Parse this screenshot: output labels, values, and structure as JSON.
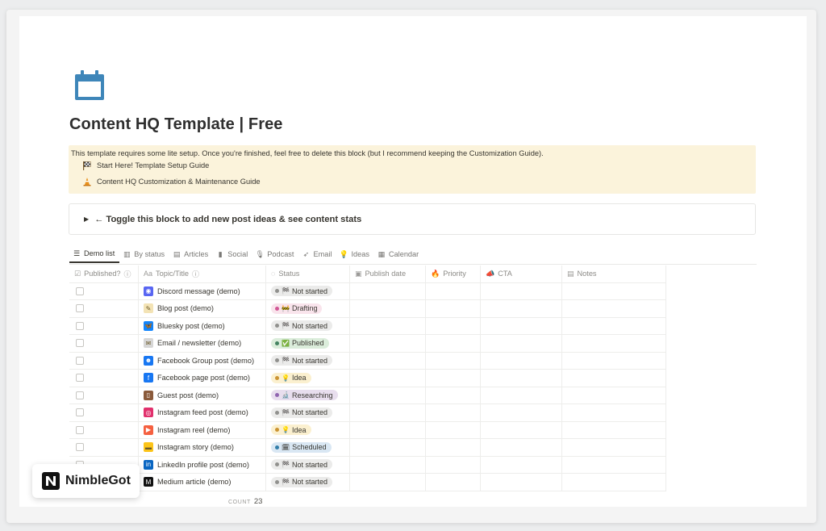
{
  "page": {
    "icon": "calendar-icon",
    "title": "Content HQ Template | Free"
  },
  "callout": {
    "text": "This template requires some lite setup. Once you're finished, feel free to delete this block (but I recommend keeping the Customization Guide).",
    "links": [
      {
        "icon": "checkered-flag-icon",
        "label": "Start Here! Template Setup Guide"
      },
      {
        "icon": "traffic-cone-icon",
        "label": "Content HQ Customization & Maintenance Guide"
      }
    ]
  },
  "toggle": {
    "label": "← Toggle this block to add new post ideas & see content stats"
  },
  "tabs": [
    {
      "icon": "list-icon",
      "label": "Demo list",
      "active": true
    },
    {
      "icon": "board-icon",
      "label": "By status"
    },
    {
      "icon": "gallery-icon",
      "label": "Articles"
    },
    {
      "icon": "phone-icon",
      "label": "Social"
    },
    {
      "icon": "microphone-icon",
      "label": "Podcast"
    },
    {
      "icon": "send-icon",
      "label": "Email"
    },
    {
      "icon": "lightbulb-icon",
      "label": "Ideas"
    },
    {
      "icon": "calendar-view-icon",
      "label": "Calendar"
    }
  ],
  "table": {
    "columns": [
      {
        "icon": "checkbox-icon",
        "label": "Published?",
        "info": "ⓘ"
      },
      {
        "icon": "text-aa-icon",
        "label": "Topic/Title",
        "info": "ⓘ"
      },
      {
        "icon": "status-icon",
        "label": "Status"
      },
      {
        "icon": "date-icon",
        "label": "Publish date"
      },
      {
        "icon": "flame-icon",
        "label": "Priority"
      },
      {
        "icon": "megaphone-icon",
        "label": "CTA"
      },
      {
        "icon": "notes-icon",
        "label": "Notes"
      }
    ],
    "rows": [
      {
        "title": "Discord message (demo)",
        "icon": "discord-icon",
        "icon_color": "#5865f2",
        "status": "Not started",
        "status_emoji": "🏁",
        "status_key": "gray"
      },
      {
        "title": "Blog post (demo)",
        "icon": "memo-icon",
        "icon_color": "#f3e3b5",
        "status": "Drafting",
        "status_emoji": "🚧",
        "status_key": "pink"
      },
      {
        "title": "Bluesky post (demo)",
        "icon": "bluesky-icon",
        "icon_color": "#1185fe",
        "status": "Not started",
        "status_emoji": "🏁",
        "status_key": "gray"
      },
      {
        "title": "Email / newsletter (demo)",
        "icon": "envelope-icon",
        "icon_color": "#d6d6d6",
        "status": "Published",
        "status_emoji": "✅",
        "status_key": "green"
      },
      {
        "title": "Facebook Group post (demo)",
        "icon": "facebook-group-icon",
        "icon_color": "#1877f2",
        "status": "Not started",
        "status_emoji": "🏁",
        "status_key": "gray"
      },
      {
        "title": "Facebook page post (demo)",
        "icon": "facebook-icon",
        "icon_color": "#1877f2",
        "status": "Idea",
        "status_emoji": "💡",
        "status_key": "yellow"
      },
      {
        "title": "Guest post (demo)",
        "icon": "door-icon",
        "icon_color": "#8a5a3b",
        "status": "Researching",
        "status_emoji": "🔬",
        "status_key": "purple"
      },
      {
        "title": "Instagram feed post (demo)",
        "icon": "instagram-icon",
        "icon_color": "#e1306c",
        "status": "Not started",
        "status_emoji": "🏁",
        "status_key": "gray"
      },
      {
        "title": "Instagram reel (demo)",
        "icon": "instagram-reel-icon",
        "icon_color": "#f56040",
        "status": "Idea",
        "status_emoji": "💡",
        "status_key": "yellow"
      },
      {
        "title": "Instagram story (demo)",
        "icon": "instagram-story-icon",
        "icon_color": "#fcc419",
        "status": "Scheduled",
        "status_emoji": "🗓",
        "status_key": "blue"
      },
      {
        "title": "LinkedIn profile post (demo)",
        "icon": "linkedin-icon",
        "icon_color": "#0a66c2",
        "status": "Not started",
        "status_emoji": "🏁",
        "status_key": "gray"
      },
      {
        "title": "Medium article (demo)",
        "icon": "medium-icon",
        "icon_color": "#111111",
        "status": "Not started",
        "status_emoji": "🏁",
        "status_key": "gray"
      }
    ],
    "count_label": "COUNT",
    "count_value": "23"
  },
  "status_colors": {
    "gray": {
      "bg": "#ebebea",
      "dot": "#91918e"
    },
    "pink": {
      "bg": "#f9e4ec",
      "dot": "#d15796"
    },
    "green": {
      "bg": "#dbeddb",
      "dot": "#448361"
    },
    "yellow": {
      "bg": "#fbf0cf",
      "dot": "#cb9433"
    },
    "purple": {
      "bg": "#e8deee",
      "dot": "#9065b0"
    },
    "blue": {
      "bg": "#d9e7f3",
      "dot": "#337ea9"
    }
  },
  "brand": {
    "name": "NimbleGot",
    "logo": "nimblegot-logo-icon"
  }
}
